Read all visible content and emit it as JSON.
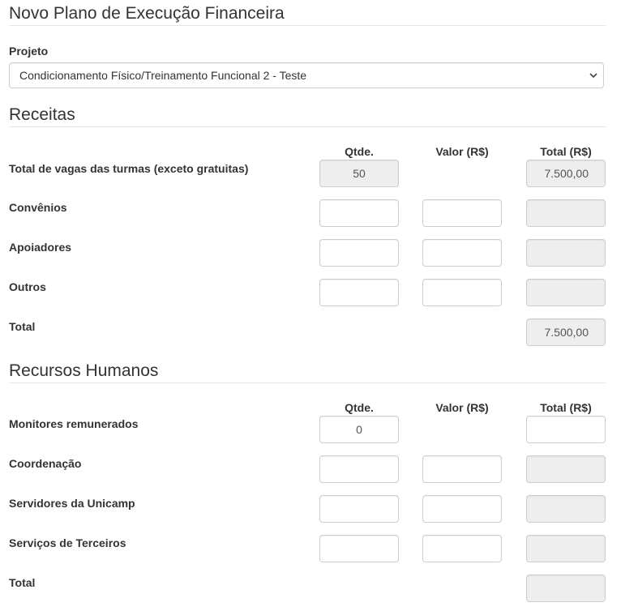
{
  "page": {
    "title": "Novo Plano de Execução Financeira"
  },
  "project": {
    "label": "Projeto",
    "selected": "Condicionamento Físico/Treinamento Funcional 2 - Teste"
  },
  "receitas": {
    "title": "Receitas",
    "headers": {
      "qty": "Qtde.",
      "value": "Valor (R$)",
      "total": "Total (R$)"
    },
    "rows": [
      {
        "label": "Total de vagas das turmas (exceto gratuitas)",
        "qty": "50",
        "value": "",
        "total": "7.500,00"
      },
      {
        "label": "Convênios",
        "qty": "",
        "value": "",
        "total": ""
      },
      {
        "label": "Apoiadores",
        "qty": "",
        "value": "",
        "total": ""
      },
      {
        "label": "Outros",
        "qty": "",
        "value": "",
        "total": ""
      }
    ],
    "total": {
      "label": "Total",
      "value": "7.500,00"
    }
  },
  "recursos": {
    "title": "Recursos Humanos",
    "headers": {
      "qty": "Qtde.",
      "value": "Valor (R$)",
      "total": "Total (R$)"
    },
    "rows": [
      {
        "label": "Monitores remunerados",
        "qty": "0",
        "value": "",
        "total": ""
      },
      {
        "label": "Coordenação",
        "qty": "",
        "value": "",
        "total": ""
      },
      {
        "label": "Servidores da Unicamp",
        "qty": "",
        "value": "",
        "total": ""
      },
      {
        "label": "Serviços de Terceiros",
        "qty": "",
        "value": "",
        "total": ""
      }
    ],
    "total": {
      "label": "Total",
      "value": ""
    }
  },
  "icons": {
    "select_arrow": "chevron-down-icon"
  }
}
